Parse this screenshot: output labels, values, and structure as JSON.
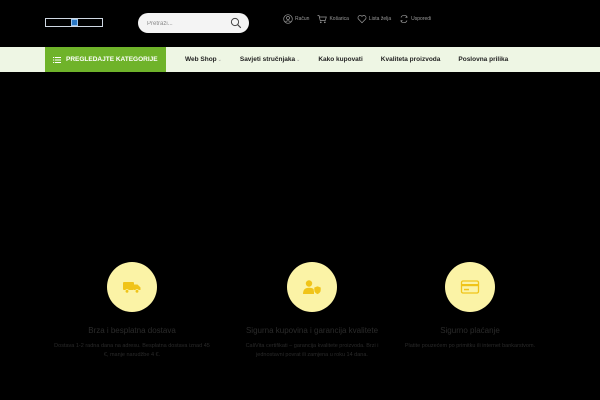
{
  "header": {
    "search": {
      "placeholder": "Pretraži..."
    },
    "top_links": [
      {
        "icon": "user-icon",
        "label": "Račun"
      },
      {
        "icon": "cart-icon",
        "label": "Košarica"
      },
      {
        "icon": "heart-icon",
        "label": "Lista želja"
      },
      {
        "icon": "compare-icon",
        "label": "Usporedi"
      }
    ]
  },
  "navbar": {
    "categories_button": "PREGLEDAJTE KATEGORIJE",
    "items": [
      {
        "label": "Web Shop",
        "has_dropdown": true
      },
      {
        "label": "Savjeti stručnjaka",
        "has_dropdown": true
      },
      {
        "label": "Kako kupovati",
        "has_dropdown": false
      },
      {
        "label": "Kvaliteta proizvoda",
        "has_dropdown": false
      },
      {
        "label": "Poslovna prilika",
        "has_dropdown": false
      }
    ]
  },
  "features": [
    {
      "icon": "truck-icon",
      "title": "Brza i besplatna dostava",
      "description": "Dostava 1-2 radna dana na adresu. Besplatna dostava iznad 45 €, manje narudžbe 4 €."
    },
    {
      "icon": "shield-user-icon",
      "title": "Sigurna kupovina i garancija kvalitete",
      "description": "CaliVita certifikati – garancija kvalitete proizvoda. Brzi i jednostavni povrat ili zamjena u roku 14 dana."
    },
    {
      "icon": "credit-card-icon",
      "title": "Sigurno plaćanje",
      "description": "Platite pouzećem po primitku ili internet bankarstvom."
    }
  ],
  "colors": {
    "accent_green": "#6fb32a",
    "nav_background": "#eef6e4",
    "feature_circle": "#fbf3a6",
    "feature_icon": "#f0c419"
  }
}
